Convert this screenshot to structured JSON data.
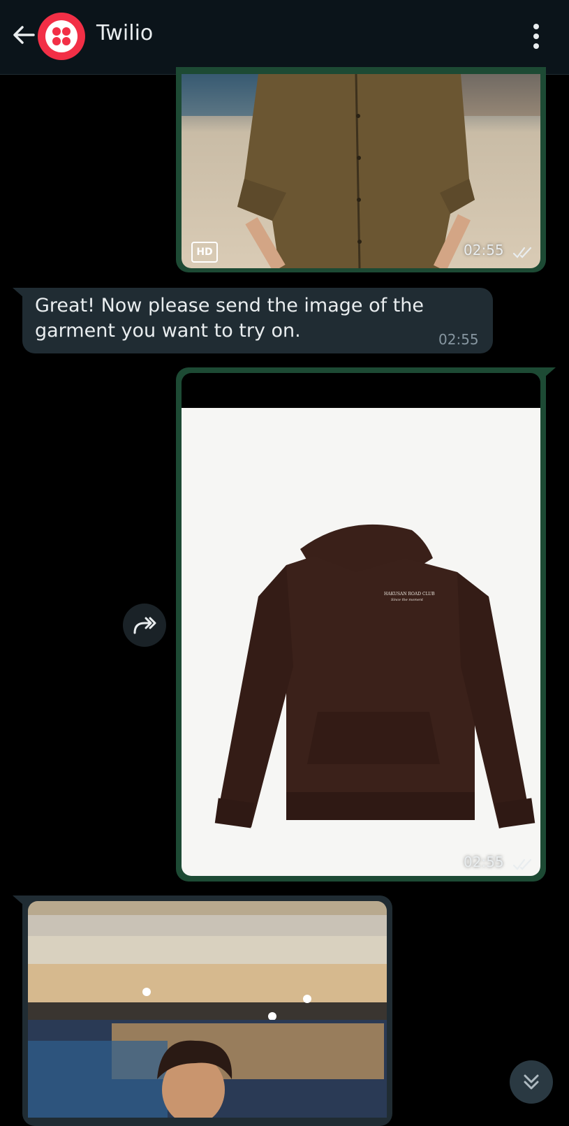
{
  "header": {
    "back_icon": "arrow-left-icon",
    "contact_name": "Twilio",
    "avatar_icon": "twilio-logo-icon",
    "menu_icon": "more-vertical-icon"
  },
  "colors": {
    "header_bg": "#0b141a",
    "outgoing_bubble": "#1d4a34",
    "incoming_bubble": "#202c33",
    "twilio_red": "#f22f46"
  },
  "messages": [
    {
      "type": "image",
      "direction": "outgoing",
      "badge": "HD",
      "time": "02:55",
      "status_icon": "double-check-icon"
    },
    {
      "type": "text",
      "direction": "incoming",
      "text": "Great!  Now please send the image of the garment you want to try on.",
      "time": "02:55"
    },
    {
      "type": "image",
      "direction": "outgoing",
      "time": "02:55",
      "status_icon": "double-check-icon",
      "forward_icon": "forward-icon"
    },
    {
      "type": "image",
      "direction": "incoming"
    }
  ],
  "scroll_down_icon": "chevrons-down-icon"
}
